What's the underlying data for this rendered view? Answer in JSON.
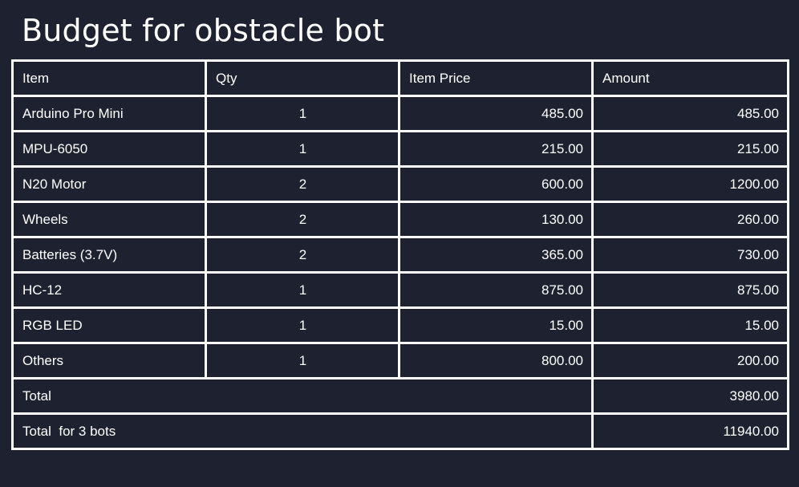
{
  "title": "Budget for obstacle bot",
  "table": {
    "headers": [
      "Item",
      "Qty",
      "Item Price",
      "Amount"
    ],
    "rows": [
      [
        "Arduino Pro Mini",
        "1",
        "485.00",
        "485.00"
      ],
      [
        "MPU-6050",
        "1",
        "215.00",
        "215.00"
      ],
      [
        "N20 Motor",
        "2",
        "600.00",
        "1200.00"
      ],
      [
        "Wheels",
        "2",
        "130.00",
        "260.00"
      ],
      [
        "Batteries (3.7V)",
        "2",
        "365.00",
        "730.00"
      ],
      [
        "HC-12",
        "1",
        "875.00",
        "875.00"
      ],
      [
        "RGB LED",
        "1",
        "15.00",
        "15.00"
      ],
      [
        "Others",
        "1",
        "800.00",
        "200.00"
      ]
    ],
    "totals": [
      {
        "label": "Total",
        "amount": "3980.00"
      },
      {
        "label": "Total  for 3 bots",
        "amount": "11940.00"
      }
    ]
  },
  "colors": {
    "background": "#1e2230",
    "border": "#ffffff",
    "text": "#ffffff"
  }
}
